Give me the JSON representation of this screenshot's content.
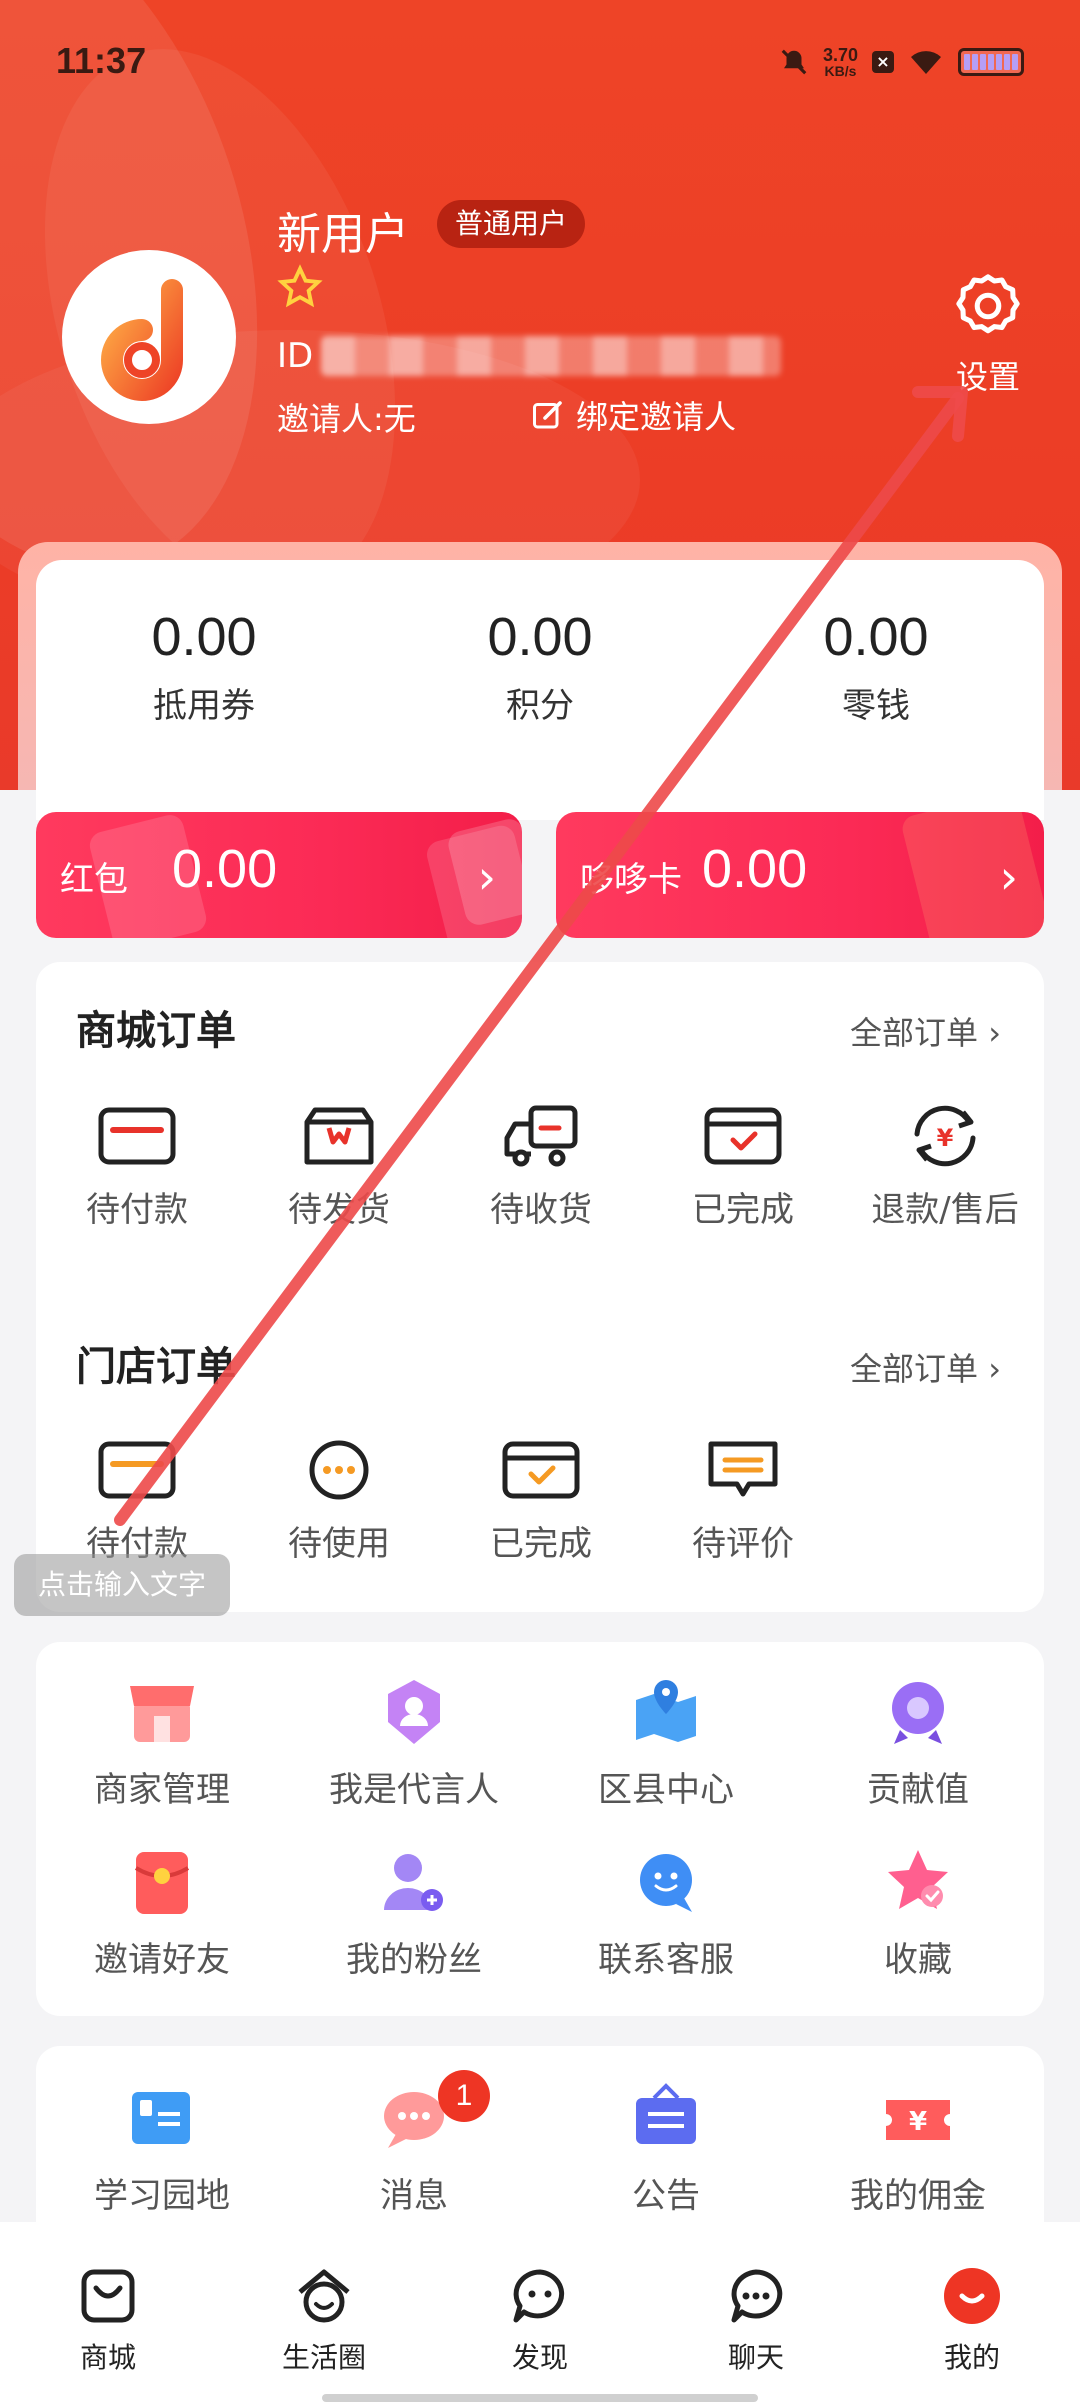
{
  "status_bar": {
    "time": "11:37",
    "net_speed": "3.70",
    "net_unit": "KB/s"
  },
  "profile": {
    "name": "新用户",
    "badge": "普通用户",
    "id_label": "ID",
    "inviter": "邀请人:无",
    "bind_inviter": "绑定邀请人",
    "settings_label": "设置"
  },
  "stats": [
    {
      "value": "0.00",
      "label": "抵用券"
    },
    {
      "value": "0.00",
      "label": "积分"
    },
    {
      "value": "0.00",
      "label": "零钱"
    }
  ],
  "cards": {
    "red_packet": {
      "label": "红包",
      "value": "0.00"
    },
    "duoduo_card": {
      "label": "哆哆卡",
      "value": "0.00"
    }
  },
  "mall_orders": {
    "title": "商城订单",
    "all_label": "全部订单",
    "items": [
      {
        "label": "待付款",
        "icon": "card-icon"
      },
      {
        "label": "待发货",
        "icon": "box-icon"
      },
      {
        "label": "待收货",
        "icon": "truck-icon"
      },
      {
        "label": "已完成",
        "icon": "completed-icon"
      },
      {
        "label": "退款/售后",
        "icon": "refund-icon"
      }
    ]
  },
  "store_orders": {
    "title": "门店订单",
    "all_label": "全部订单",
    "items": [
      {
        "label": "待付款",
        "icon": "card-icon"
      },
      {
        "label": "待使用",
        "icon": "dots-circle-icon"
      },
      {
        "label": "已完成",
        "icon": "completed-icon"
      },
      {
        "label": "待评价",
        "icon": "comment-icon"
      }
    ]
  },
  "services": [
    {
      "label": "商家管理",
      "icon": "shop-icon"
    },
    {
      "label": "我是代言人",
      "icon": "spokesperson-icon"
    },
    {
      "label": "区县中心",
      "icon": "map-pin-icon"
    },
    {
      "label": "贡献值",
      "icon": "contribution-icon"
    },
    {
      "label": "邀请好友",
      "icon": "red-envelope-icon"
    },
    {
      "label": "我的粉丝",
      "icon": "fans-icon"
    },
    {
      "label": "联系客服",
      "icon": "customer-service-icon"
    },
    {
      "label": "收藏",
      "icon": "star-icon"
    }
  ],
  "tools": [
    {
      "label": "学习园地",
      "icon": "book-icon"
    },
    {
      "label": "消息",
      "icon": "message-icon",
      "badge": "1"
    },
    {
      "label": "公告",
      "icon": "notice-icon"
    },
    {
      "label": "我的佣金",
      "icon": "commission-icon"
    }
  ],
  "toast": "点击输入文字",
  "bottom_nav": [
    {
      "label": "商城",
      "icon": "shopping-bag-icon"
    },
    {
      "label": "生活圈",
      "icon": "life-circle-icon"
    },
    {
      "label": "发现",
      "icon": "discover-icon"
    },
    {
      "label": "聊天",
      "icon": "chat-icon"
    },
    {
      "label": "我的",
      "icon": "profile-icon",
      "active": true
    }
  ],
  "colors": {
    "brand_red": "#ee4427",
    "card_pink": "#fb2a55",
    "orange_accent": "#f59a23"
  }
}
